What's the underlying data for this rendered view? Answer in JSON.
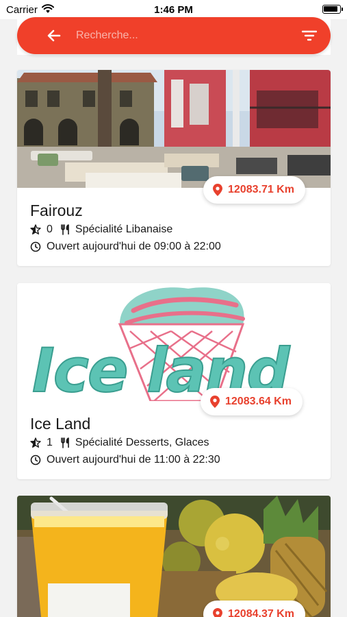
{
  "status_bar": {
    "carrier": "Carrier",
    "time": "1:46 PM"
  },
  "search": {
    "placeholder": "Recherche..."
  },
  "colors": {
    "accent": "#f0402a",
    "distance": "#e8412e",
    "background": "#f2f2f2"
  },
  "restaurants": [
    {
      "name": "Fairouz",
      "rating": "0",
      "specialty": "Spécialité Libanaise",
      "hours": "Ouvert aujourd'hui de 09:00 à 22:00",
      "distance": "12083.71 Km",
      "image": "terrace-photo"
    },
    {
      "name": "Ice Land",
      "rating": "1",
      "specialty": "Spécialité Desserts, Glaces",
      "hours": "Ouvert aujourd'hui de 11:00 à 22:30",
      "distance": "12083.64 Km",
      "image": "ice-land-logo"
    },
    {
      "name": "",
      "rating": "",
      "specialty": "",
      "hours": "",
      "distance": "12084.37 Km",
      "image": "juice-photo"
    }
  ]
}
